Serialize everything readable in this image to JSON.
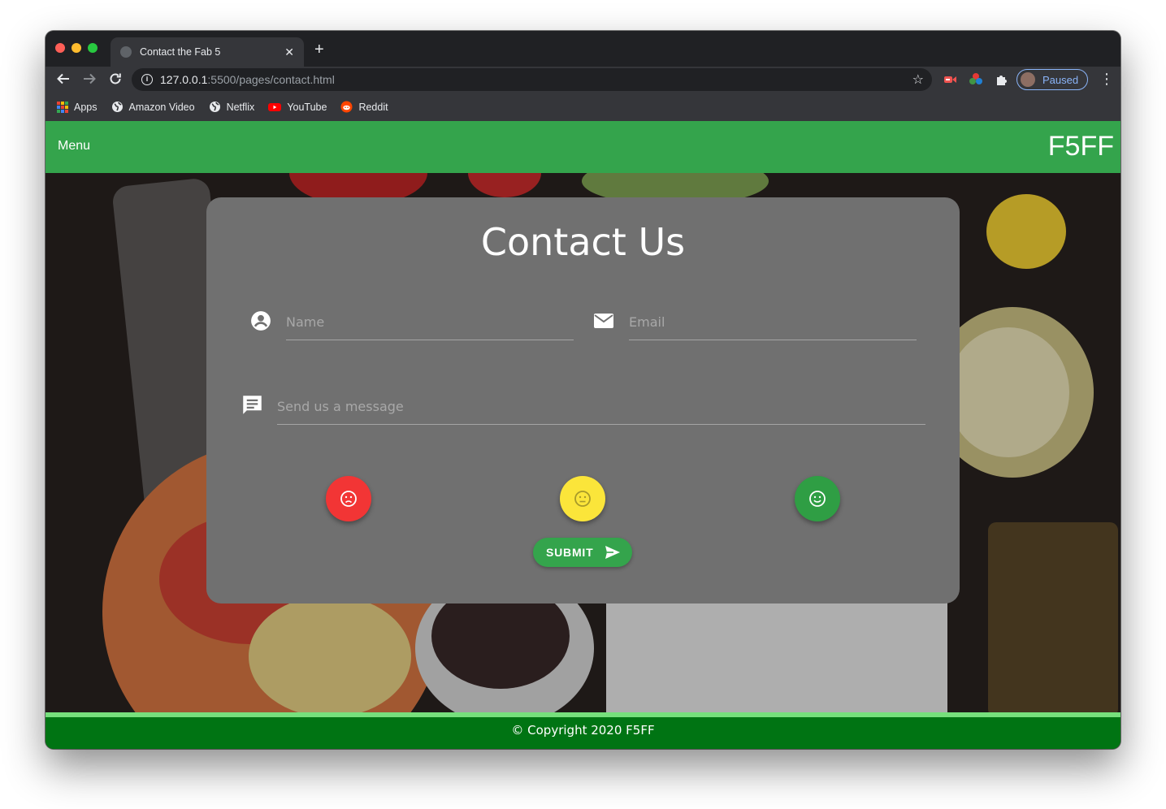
{
  "browser": {
    "tab_title": "Contact the Fab 5",
    "url_host": "127.0.0.1",
    "url_path": ":5500/pages/contact.html",
    "profile_status": "Paused",
    "bookmarks": [
      {
        "label": "Apps",
        "icon": "apps-grid-icon"
      },
      {
        "label": "Amazon Video",
        "icon": "globe-icon"
      },
      {
        "label": "Netflix",
        "icon": "globe-icon"
      },
      {
        "label": "YouTube",
        "icon": "youtube-icon"
      },
      {
        "label": "Reddit",
        "icon": "reddit-icon"
      }
    ]
  },
  "navbar": {
    "menu_label": "Menu",
    "brand": "F5FF",
    "color": "#34a44c"
  },
  "contact": {
    "heading": "Contact Us",
    "name_placeholder": "Name",
    "email_placeholder": "Email",
    "message_placeholder": "Send us a message",
    "ratings": [
      {
        "name": "sad",
        "color": "#f23535",
        "icon": "sad-face-icon"
      },
      {
        "name": "neutral",
        "color": "#fbe53a",
        "icon": "neutral-face-icon"
      },
      {
        "name": "happy",
        "color": "#2f9e44",
        "icon": "happy-face-icon"
      }
    ],
    "submit_label": "SUBMIT"
  },
  "footer": {
    "copyright": "© Copyright 2020 F5FF",
    "color": "#007413"
  }
}
